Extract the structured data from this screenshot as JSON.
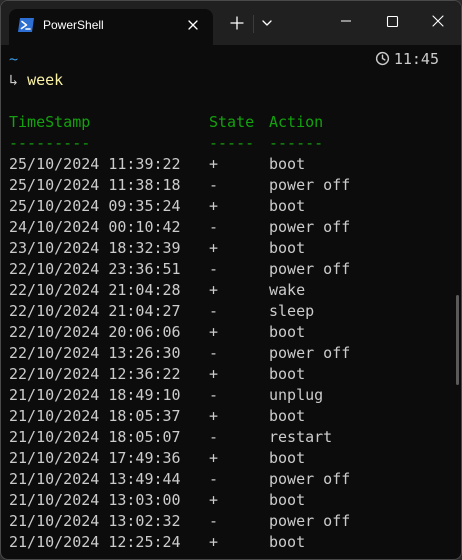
{
  "window": {
    "tab_title": "PowerShell",
    "icons": {
      "tab": "powershell-icon",
      "close_tab": "close-icon",
      "new_tab": "plus-icon",
      "dropdown": "chevron-down-icon",
      "minimize": "minimize-icon",
      "maximize": "maximize-icon",
      "close": "close-icon"
    }
  },
  "prompt": {
    "path": "~",
    "arrow": "↳",
    "command": "week",
    "time": "11:45",
    "clock_icon": "clock-icon"
  },
  "colors": {
    "background": "#0c0c0c",
    "header": "#13a10e",
    "command": "#f9f1a5",
    "path": "#3a96dd",
    "text": "#cccccc"
  },
  "table": {
    "headers": [
      "TimeStamp",
      "State",
      "Action"
    ],
    "separators": [
      "---------",
      "-----",
      "------"
    ],
    "rows": [
      [
        "25/10/2024 11:39:22",
        "+",
        "boot"
      ],
      [
        "25/10/2024 11:38:18",
        "-",
        "power off"
      ],
      [
        "25/10/2024 09:35:24",
        "+",
        "boot"
      ],
      [
        "24/10/2024 00:10:42",
        "-",
        "power off"
      ],
      [
        "23/10/2024 18:32:39",
        "+",
        "boot"
      ],
      [
        "22/10/2024 23:36:51",
        "-",
        "power off"
      ],
      [
        "22/10/2024 21:04:28",
        "+",
        "wake"
      ],
      [
        "22/10/2024 21:04:27",
        "-",
        "sleep"
      ],
      [
        "22/10/2024 20:06:06",
        "+",
        "boot"
      ],
      [
        "22/10/2024 13:26:30",
        "-",
        "power off"
      ],
      [
        "22/10/2024 12:36:22",
        "+",
        "boot"
      ],
      [
        "21/10/2024 18:49:10",
        "-",
        "unplug"
      ],
      [
        "21/10/2024 18:05:37",
        "+",
        "boot"
      ],
      [
        "21/10/2024 18:05:07",
        "-",
        "restart"
      ],
      [
        "21/10/2024 17:49:36",
        "+",
        "boot"
      ],
      [
        "21/10/2024 13:49:44",
        "-",
        "power off"
      ],
      [
        "21/10/2024 13:03:00",
        "+",
        "boot"
      ],
      [
        "21/10/2024 13:02:32",
        "-",
        "power off"
      ],
      [
        "21/10/2024 12:25:24",
        "+",
        "boot"
      ]
    ]
  }
}
